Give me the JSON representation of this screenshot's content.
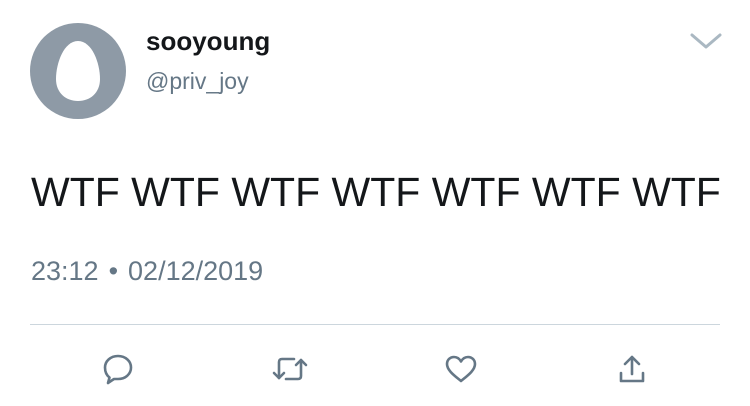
{
  "user": {
    "display_name": "sooyoung",
    "handle": "@priv_joy",
    "avatar_icon": "default-egg-avatar"
  },
  "tweet": {
    "text": "WTF WTF WTF WTF WTF WTF WTF",
    "time": "23:12",
    "separator": "•",
    "date": "02/12/2019"
  },
  "actions": {
    "reply_icon": "reply-icon",
    "retweet_icon": "retweet-icon",
    "like_icon": "heart-icon",
    "share_icon": "share-icon"
  },
  "colors": {
    "avatar_bg": "#8e9aa6",
    "icon": "#657786",
    "text": "#14171a",
    "muted": "#657786"
  }
}
